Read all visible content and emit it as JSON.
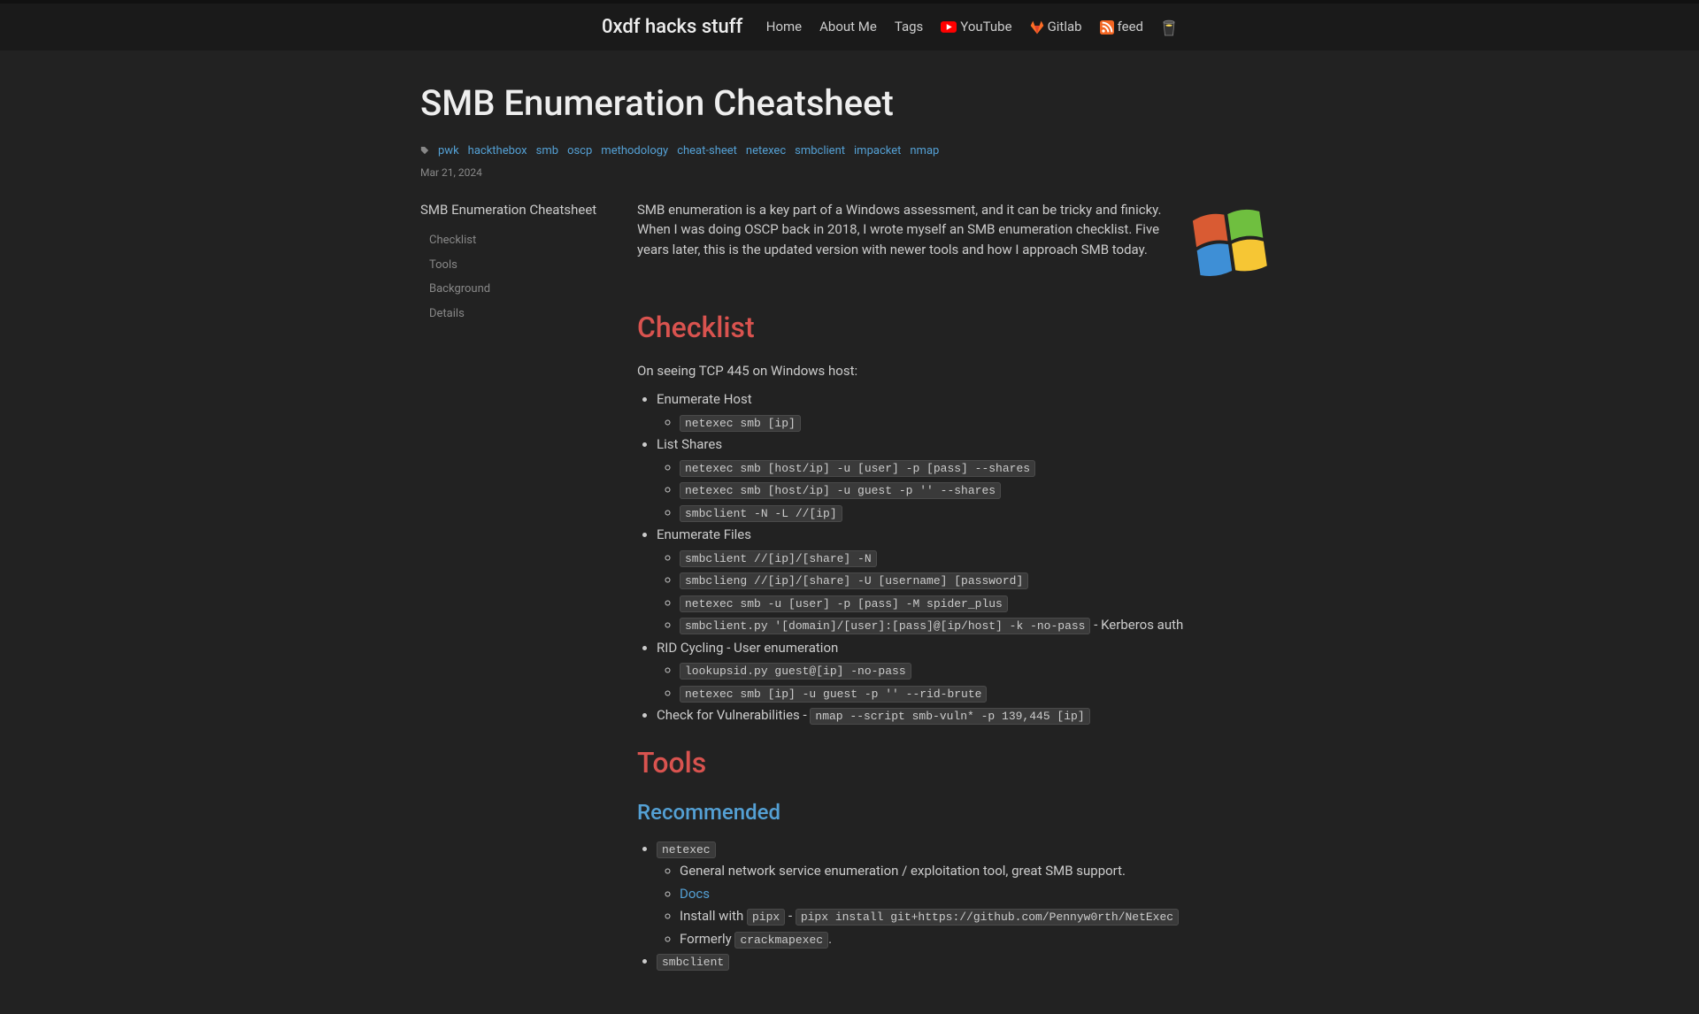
{
  "brand": "0xdf hacks stuff",
  "nav": {
    "home": "Home",
    "about": "About Me",
    "tags": "Tags",
    "youtube": "YouTube",
    "gitlab": "Gitlab",
    "feed": "feed"
  },
  "post": {
    "title": "SMB Enumeration Cheatsheet",
    "date": "Mar 21, 2024",
    "tags": [
      "pwk",
      "hackthebox",
      "smb",
      "oscp",
      "methodology",
      "cheat-sheet",
      "netexec",
      "smbclient",
      "impacket",
      "nmap"
    ]
  },
  "toc": {
    "title": "SMB Enumeration Cheatsheet",
    "items": [
      "Checklist",
      "Tools",
      "Background",
      "Details"
    ]
  },
  "intro": "SMB enumeration is a key part of a Windows assessment, and it can be tricky and finicky. When I was doing OSCP back in 2018, I wrote myself an SMB enumeration checklist. Five years later, this is the updated version with newer tools and how I approach SMB today.",
  "checklist": {
    "heading": "Checklist",
    "lead": "On seeing TCP 445 on Windows host:",
    "enum_host": {
      "label": "Enumerate Host",
      "cmds": [
        "netexec smb [ip]"
      ]
    },
    "list_shares": {
      "label": "List Shares",
      "cmds": [
        "netexec smb [host/ip] -u [user] -p [pass] --shares",
        "netexec smb [host/ip] -u guest -p '' --shares",
        "smbclient -N -L //[ip]"
      ]
    },
    "enum_files": {
      "label": "Enumerate Files",
      "cmds": [
        "smbclient //[ip]/[share] -N",
        "smbclieng //[ip]/[share] -U [username] [password]",
        "netexec smb -u [user] -p [pass] -M spider_plus",
        "smbclient.py '[domain]/[user]:[pass]@[ip/host] -k -no-pass"
      ],
      "suffix_last": " - Kerberos auth"
    },
    "rid": {
      "label": "RID Cycling - User enumeration",
      "cmds": [
        "lookupsid.py guest@[ip] -no-pass",
        "netexec smb [ip] -u guest -p '' --rid-brute"
      ]
    },
    "vuln": {
      "label_prefix": "Check for Vulnerabilities - ",
      "cmd": "nmap --script smb-vuln* -p 139,445 [ip]"
    }
  },
  "tools": {
    "heading": "Tools",
    "recommended": "Recommended",
    "netexec": {
      "name": "netexec",
      "desc": "General network service enumeration / exploitation tool, great SMB support.",
      "docs": "Docs",
      "install_prefix": "Install with ",
      "install_tool": "pipx",
      "install_sep": " - ",
      "install_cmd": "pipx install git+https://github.com/Pennyw0rth/NetExec",
      "formerly_prefix": "Formerly ",
      "formerly_name": "crackmapexec",
      "formerly_suffix": "."
    },
    "smbclient": {
      "name": "smbclient"
    }
  }
}
